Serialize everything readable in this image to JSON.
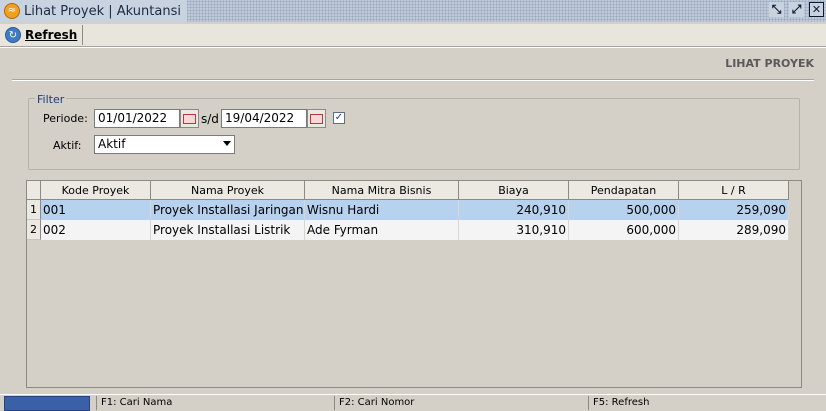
{
  "window": {
    "title": "Lihat Proyek | Akuntansi"
  },
  "toolbar": {
    "refresh_label": "Refresh"
  },
  "page": {
    "title": "LIHAT PROYEK"
  },
  "filter": {
    "legend": "Filter",
    "periode_label": "Periode:",
    "date_from": "01/01/2022",
    "date_separator": "s/d",
    "date_to": "19/04/2022",
    "aktif_label": "Aktif:",
    "aktif_value": "Aktif",
    "checkbox_checked": true
  },
  "table": {
    "columns": [
      "Kode Proyek",
      "Nama Proyek",
      "Nama Mitra Bisnis",
      "Biaya",
      "Pendapatan",
      "L / R"
    ],
    "rows": [
      {
        "no": "1",
        "kode": "001",
        "nama": "Proyek Installasi Jaringan",
        "mitra": "Wisnu Hardi",
        "biaya": "240,910",
        "pendapatan": "500,000",
        "lr": "259,090"
      },
      {
        "no": "2",
        "kode": "002",
        "nama": "Proyek Installasi Listrik",
        "mitra": "Ade Fyrman",
        "biaya": "310,910",
        "pendapatan": "600,000",
        "lr": "289,090"
      }
    ]
  },
  "statusbar": {
    "f1": "F1: Cari Nama",
    "f2": "F2: Cari Nomor",
    "f5": "F5: Refresh"
  }
}
